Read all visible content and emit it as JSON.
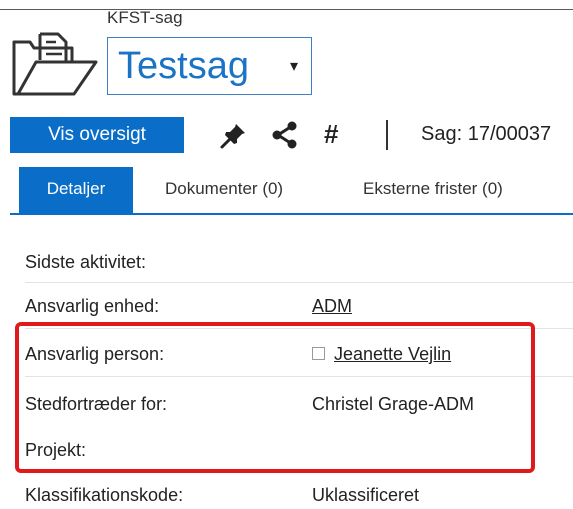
{
  "header": {
    "case_type": "KFST-sag",
    "title": "Testsag",
    "title_caret": "▾"
  },
  "toolbar": {
    "overview_button": "Vis oversigt",
    "pin_icon": "pin-icon",
    "share_icon": "share-icon",
    "hash_icon": "#",
    "case_number": "Sag: 17/00037"
  },
  "tabs": [
    {
      "label": "Detaljer",
      "active": true
    },
    {
      "label": "Dokumenter (0)",
      "active": false
    },
    {
      "label": "Eksterne frister (0)",
      "active": false
    }
  ],
  "fields": [
    {
      "label": "Sidste aktivitet:",
      "value": ""
    },
    {
      "label": "Ansvarlig enhed:",
      "value": "ADM"
    },
    {
      "label": "Ansvarlig person:",
      "value": "Jeanette Vejlin"
    },
    {
      "label": "Stedfortræder for:",
      "value": "Christel Grage-ADM"
    },
    {
      "label": "Projekt:",
      "value": ""
    },
    {
      "label": "Klassifikationskode:",
      "value": "Uklassificeret"
    }
  ],
  "colors": {
    "accent": "#0a6ec9",
    "highlight": "#e01a1a"
  }
}
